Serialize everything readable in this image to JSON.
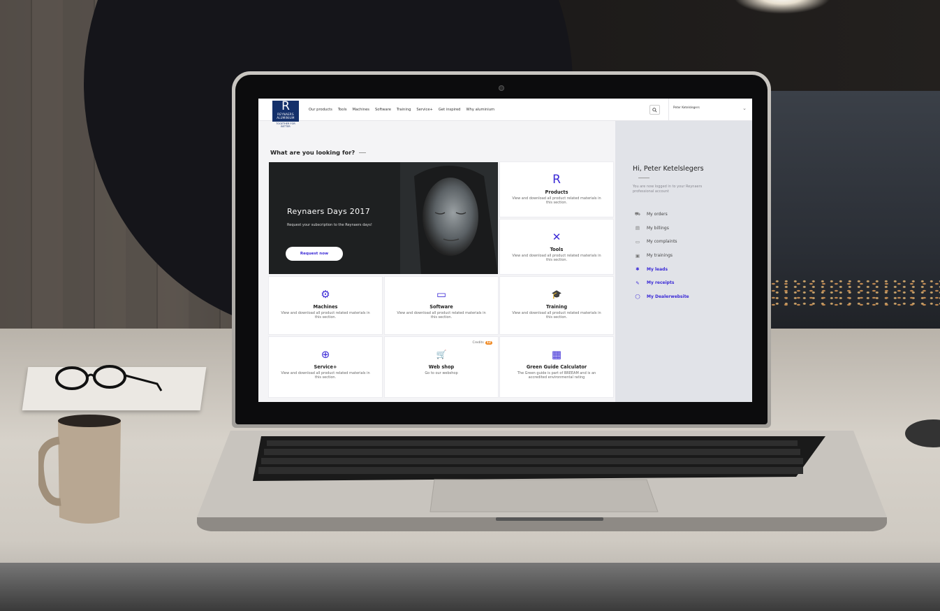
{
  "nav": {
    "logo_letter": "R",
    "logo_name": "REYNAERS",
    "logo_sub": "ALUMINIUM",
    "tagline": "TOGETHER FOR BETTER",
    "menu": [
      "Our products",
      "Tools",
      "Machines",
      "Software",
      "Training",
      "Service+",
      "Get inspired",
      "Why aluminium"
    ],
    "search_icon": "search-icon",
    "user_name": "Peter Ketelslegers",
    "user_chevron_icon": "chevron-down-icon"
  },
  "main": {
    "heading": "What are you looking for?"
  },
  "hero": {
    "title": "Reynaers Days 2017",
    "subtitle": "Request your subscription to the Reynaers days!",
    "button": "Request now"
  },
  "cards": [
    {
      "icon": "reynaers-r-icon",
      "glyph": "R",
      "title": "Products",
      "desc": "View and download all product related materials in this section."
    },
    {
      "icon": "tools-icon",
      "glyph": "✕",
      "title": "Tools",
      "desc": "View and download all product related materials in this section."
    },
    {
      "icon": "gear-icon",
      "glyph": "⚙",
      "title": "Machines",
      "desc": "View and download all product related materials in this section."
    },
    {
      "icon": "monitor-icon",
      "glyph": "▭",
      "title": "Software",
      "desc": "View and download all product related materials in this section."
    },
    {
      "icon": "graduation-cap-icon",
      "glyph": "🎓",
      "title": "Training",
      "desc": "View and download all product related materials in this section."
    },
    {
      "icon": "plus-circle-icon",
      "glyph": "⊕",
      "title": "Service+",
      "desc": "View and download all product related materials in this section."
    },
    {
      "icon": "cart-icon",
      "glyph": "🛒",
      "title": "Web shop",
      "desc": "Go to our webshop",
      "badge_label": "Credits",
      "badge_value": "12"
    },
    {
      "icon": "calculator-icon",
      "glyph": "▦",
      "title": "Green Guide Calculator",
      "desc": "The Green guide is part of BREEAM and is an accredited environmental rating"
    }
  ],
  "sidebar": {
    "greeting": "Hi, Peter Ketelslegers",
    "sub": "You are now logged in to your Reynaers professional account",
    "items": [
      {
        "icon": "cart-icon",
        "glyph": "⛟",
        "label": "My orders",
        "highlight": false
      },
      {
        "icon": "billing-icon",
        "glyph": "▤",
        "label": "My billings",
        "highlight": false
      },
      {
        "icon": "chat-icon",
        "glyph": "▭",
        "label": "My complaints",
        "highlight": false
      },
      {
        "icon": "training-icon",
        "glyph": "▣",
        "label": "My trainings",
        "highlight": false
      },
      {
        "icon": "leads-icon",
        "glyph": "✱",
        "label": "My leads",
        "highlight": true
      },
      {
        "icon": "receipt-icon",
        "glyph": "✎",
        "label": "My receipts",
        "highlight": true
      },
      {
        "icon": "website-icon",
        "glyph": "◯",
        "label": "My Dealerwebsite",
        "highlight": true
      }
    ]
  },
  "colors": {
    "accent": "#3b2ad6",
    "brand_navy": "#14306a",
    "badge": "#f08a24"
  }
}
